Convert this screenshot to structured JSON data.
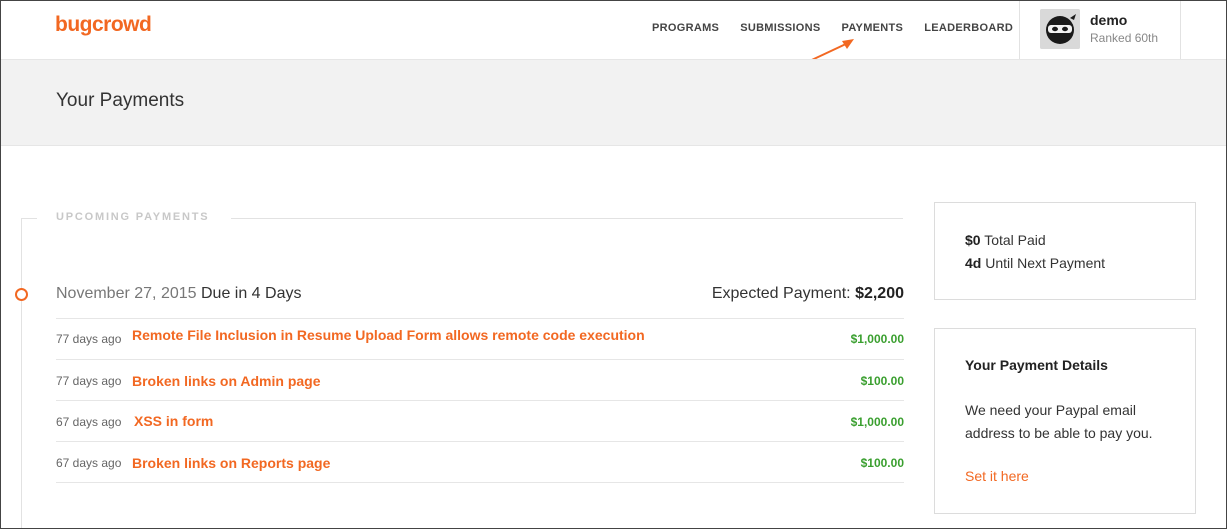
{
  "header": {
    "logo": "bugcrowd",
    "nav": [
      "PROGRAMS",
      "SUBMISSIONS",
      "PAYMENTS",
      "LEADERBOARD"
    ],
    "user": {
      "name": "demo",
      "rank": "Ranked 60th"
    }
  },
  "page": {
    "title": "Your Payments"
  },
  "upcoming": {
    "section_label": "UPCOMING PAYMENTS",
    "date": "November 27, 2015",
    "due": "Due in 4 Days",
    "expected_label": "Expected Payment:",
    "expected_value": "$2,200",
    "submissions": [
      {
        "ago": "77 days ago",
        "title": "Remote File Inclusion in Resume Upload Form allows remote code execution",
        "amount": "$1,000.00"
      },
      {
        "ago": "77 days ago",
        "title": "Broken links on Admin page",
        "amount": "$100.00"
      },
      {
        "ago": "67 days ago",
        "title": "XSS in form",
        "amount": "$1,000.00"
      },
      {
        "ago": "67 days ago",
        "title": "Broken links on Reports page",
        "amount": "$100.00"
      }
    ]
  },
  "summary": {
    "total_paid_value": "$0",
    "total_paid_label": "Total Paid",
    "next_payment_value": "4d",
    "next_payment_label": "Until Next Payment"
  },
  "payment_details": {
    "title": "Your Payment Details",
    "text": "We need your Paypal email address to be able to pay you.",
    "link": "Set it here"
  },
  "colors": {
    "accent": "#f26822",
    "amount_green": "#3a9f2f"
  },
  "icons": {
    "avatar": "ninja-avatar-icon",
    "annotation": "arrow-annotation-icon"
  }
}
